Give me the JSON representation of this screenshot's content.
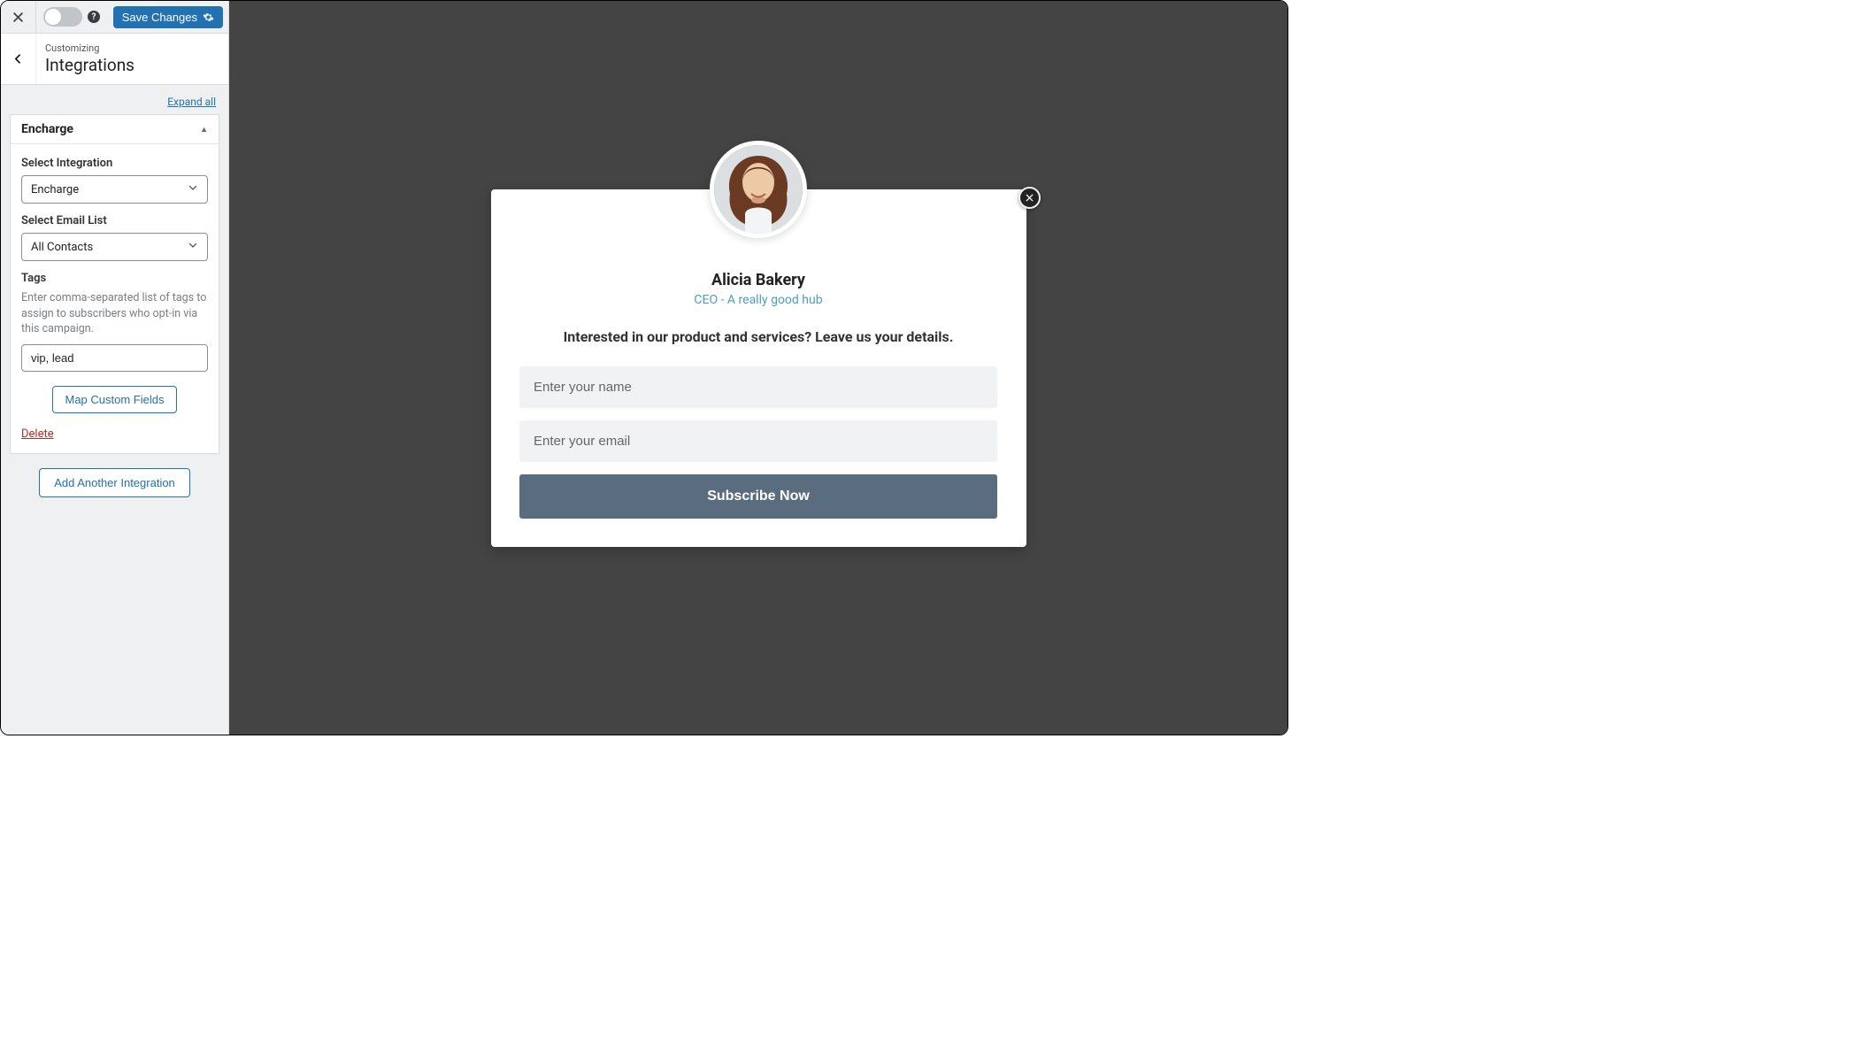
{
  "topbar": {
    "save_label": "Save Changes"
  },
  "subheader": {
    "small": "Customizing",
    "big": "Integrations"
  },
  "expand_all": "Expand all",
  "panel": {
    "title": "Encharge",
    "select_integration_label": "Select Integration",
    "select_integration_value": "Encharge",
    "select_list_label": "Select Email List",
    "select_list_value": "All Contacts",
    "tags_label": "Tags",
    "tags_help": "Enter comma-separated list of tags to assign to subscribers who opt-in via this campaign.",
    "tags_value": "vip, lead",
    "map_label": "Map Custom Fields",
    "delete_label": "Delete"
  },
  "add_integration": "Add Another Integration",
  "popup": {
    "name": "Alicia Bakery",
    "subtitle": "CEO - A really good hub",
    "headline": "Interested in our product and services? Leave us your details.",
    "name_placeholder": "Enter your name",
    "email_placeholder": "Enter your email",
    "submit_label": "Subscribe Now"
  }
}
